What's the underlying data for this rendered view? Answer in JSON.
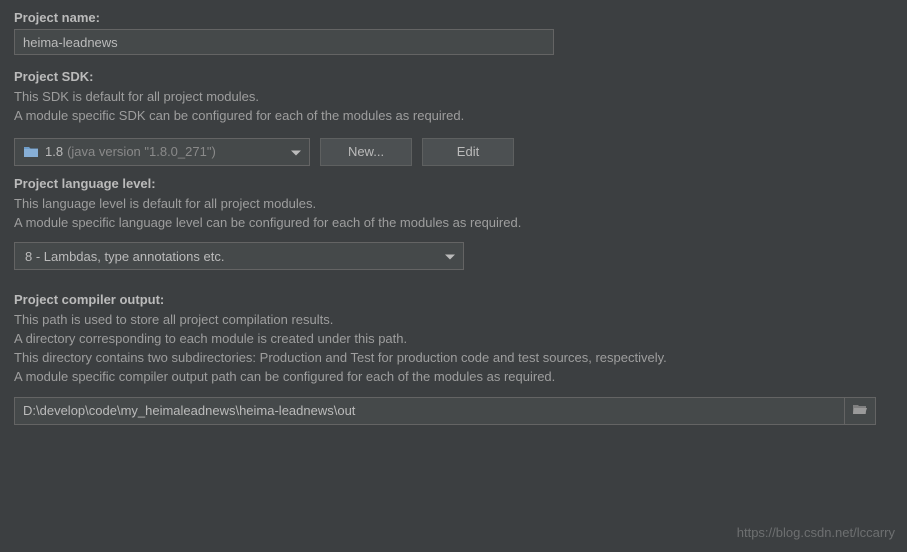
{
  "projectName": {
    "label": "Project name:",
    "value": "heima-leadnews"
  },
  "projectSdk": {
    "label": "Project SDK:",
    "desc1": "This SDK is default for all project modules.",
    "desc2": "A module specific SDK can be configured for each of the modules as required.",
    "selectedName": "1.8",
    "selectedVersion": "(java version \"1.8.0_271\")",
    "newLabel": "New...",
    "editLabel": "Edit"
  },
  "languageLevel": {
    "label": "Project language level:",
    "desc1": "This language level is default for all project modules.",
    "desc2": "A module specific language level can be configured for each of the modules as required.",
    "selected": "8 - Lambdas, type annotations etc."
  },
  "compilerOutput": {
    "label": "Project compiler output:",
    "desc1": "This path is used to store all project compilation results.",
    "desc2": "A directory corresponding to each module is created under this path.",
    "desc3": "This directory contains two subdirectories: Production and Test for production code and test sources, respectively.",
    "desc4": "A module specific compiler output path can be configured for each of the modules as required.",
    "value": "D:\\develop\\code\\my_heimaleadnews\\heima-leadnews\\out"
  },
  "watermark": "https://blog.csdn.net/lccarry"
}
